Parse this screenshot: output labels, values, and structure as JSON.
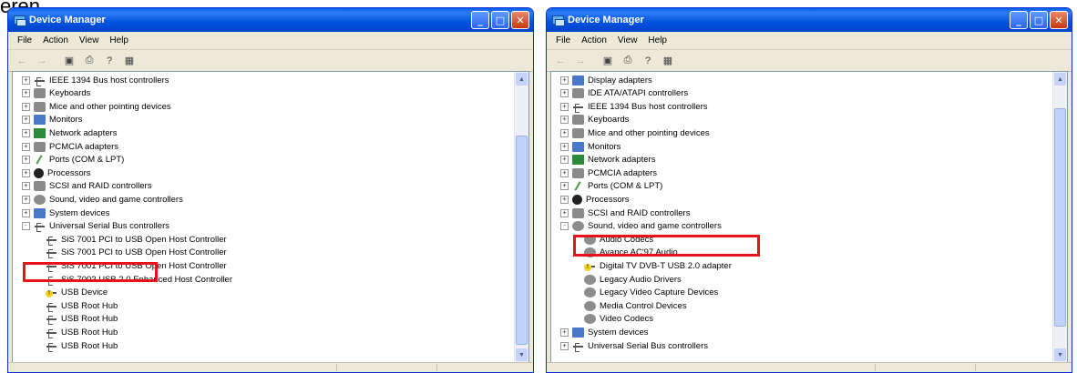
{
  "caption_top": "eren.",
  "windows": [
    {
      "title": "Device Manager",
      "menu": [
        "File",
        "Action",
        "View",
        "Help"
      ],
      "tree": [
        {
          "label": "IEEE 1394 Bus host controllers",
          "level": 1,
          "exp": "+",
          "icon": "usb-icon"
        },
        {
          "label": "Keyboards",
          "level": 1,
          "exp": "+",
          "icon": "keyboard-icon"
        },
        {
          "label": "Mice and other pointing devices",
          "level": 1,
          "exp": "+",
          "icon": "mouse-icon"
        },
        {
          "label": "Monitors",
          "level": 1,
          "exp": "+",
          "icon": "monitor-icon"
        },
        {
          "label": "Network adapters",
          "level": 1,
          "exp": "+",
          "icon": "network-icon"
        },
        {
          "label": "PCMCIA adapters",
          "level": 1,
          "exp": "+",
          "icon": "pcmcia-icon"
        },
        {
          "label": "Ports (COM & LPT)",
          "level": 1,
          "exp": "+",
          "icon": "port-icon"
        },
        {
          "label": "Processors",
          "level": 1,
          "exp": "+",
          "icon": "processor-icon"
        },
        {
          "label": "SCSI and RAID controllers",
          "level": 1,
          "exp": "+",
          "icon": "scsi-icon"
        },
        {
          "label": "Sound, video and game controllers",
          "level": 1,
          "exp": "+",
          "icon": "sound-icon"
        },
        {
          "label": "System devices",
          "level": 1,
          "exp": "+",
          "icon": "system-icon"
        },
        {
          "label": "Universal Serial Bus controllers",
          "level": 1,
          "exp": "-",
          "icon": "usb-icon"
        },
        {
          "label": "SiS 7001 PCI to USB Open Host Controller",
          "level": 2,
          "icon": "usb-icon"
        },
        {
          "label": "SiS 7001 PCI to USB Open Host Controller",
          "level": 2,
          "icon": "usb-icon"
        },
        {
          "label": "SiS 7001 PCI to USB Open Host Controller",
          "level": 2,
          "icon": "usb-icon"
        },
        {
          "label": "SiS 7002 USB 2.0 Enhanced Host Controller",
          "level": 2,
          "icon": "usb-icon"
        },
        {
          "label": "USB Device",
          "level": 2,
          "icon": "warning-icon"
        },
        {
          "label": "USB Root Hub",
          "level": 2,
          "icon": "usb-icon"
        },
        {
          "label": "USB Root Hub",
          "level": 2,
          "icon": "usb-icon"
        },
        {
          "label": "USB Root Hub",
          "level": 2,
          "icon": "usb-icon"
        },
        {
          "label": "USB Root Hub",
          "level": 2,
          "icon": "usb-icon"
        }
      ]
    },
    {
      "title": "Device Manager",
      "menu": [
        "File",
        "Action",
        "View",
        "Help"
      ],
      "tree": [
        {
          "label": "Display adapters",
          "level": 1,
          "exp": "+",
          "icon": "display-icon"
        },
        {
          "label": "IDE ATA/ATAPI controllers",
          "level": 1,
          "exp": "+",
          "icon": "ide-icon"
        },
        {
          "label": "IEEE 1394 Bus host controllers",
          "level": 1,
          "exp": "+",
          "icon": "usb-icon"
        },
        {
          "label": "Keyboards",
          "level": 1,
          "exp": "+",
          "icon": "keyboard-icon"
        },
        {
          "label": "Mice and other pointing devices",
          "level": 1,
          "exp": "+",
          "icon": "mouse-icon"
        },
        {
          "label": "Monitors",
          "level": 1,
          "exp": "+",
          "icon": "monitor-icon"
        },
        {
          "label": "Network adapters",
          "level": 1,
          "exp": "+",
          "icon": "network-icon"
        },
        {
          "label": "PCMCIA adapters",
          "level": 1,
          "exp": "+",
          "icon": "pcmcia-icon"
        },
        {
          "label": "Ports (COM & LPT)",
          "level": 1,
          "exp": "+",
          "icon": "port-icon"
        },
        {
          "label": "Processors",
          "level": 1,
          "exp": "+",
          "icon": "processor-icon"
        },
        {
          "label": "SCSI and RAID controllers",
          "level": 1,
          "exp": "+",
          "icon": "scsi-icon"
        },
        {
          "label": "Sound, video and game controllers",
          "level": 1,
          "exp": "-",
          "icon": "sound-icon"
        },
        {
          "label": "Audio Codecs",
          "level": 2,
          "icon": "sound-icon"
        },
        {
          "label": "Avance AC'97 Audio",
          "level": 2,
          "icon": "sound-icon"
        },
        {
          "label": "Digital TV DVB-T USB 2.0 adapter",
          "level": 2,
          "icon": "warning-icon"
        },
        {
          "label": "Legacy Audio Drivers",
          "level": 2,
          "icon": "sound-icon"
        },
        {
          "label": "Legacy Video Capture Devices",
          "level": 2,
          "icon": "sound-icon"
        },
        {
          "label": "Media Control Devices",
          "level": 2,
          "icon": "sound-icon"
        },
        {
          "label": "Video Codecs",
          "level": 2,
          "icon": "sound-icon"
        },
        {
          "label": "System devices",
          "level": 1,
          "exp": "+",
          "icon": "system-icon"
        },
        {
          "label": "Universal Serial Bus controllers",
          "level": 1,
          "exp": "+",
          "icon": "usb-icon"
        }
      ]
    }
  ]
}
